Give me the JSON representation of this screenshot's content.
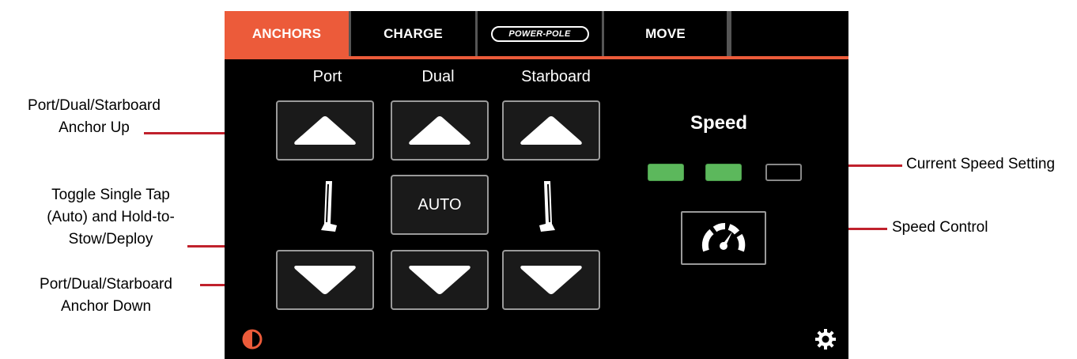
{
  "tabs": [
    {
      "label": "ANCHORS",
      "active": true
    },
    {
      "label": "CHARGE",
      "active": false
    },
    {
      "label": "POWER-POLE",
      "active": false,
      "type": "logo"
    },
    {
      "label": "MOVE",
      "active": false
    },
    {
      "label": "",
      "active": false
    }
  ],
  "columns": {
    "port": "Port",
    "dual": "Dual",
    "starboard": "Starboard"
  },
  "auto_button": "AUTO",
  "speed": {
    "label": "Speed",
    "levels": [
      {
        "on": true,
        "color": "#5cb85c"
      },
      {
        "on": true,
        "color": "#5cb85c"
      },
      {
        "on": false,
        "color": "#000000"
      }
    ]
  },
  "callouts": {
    "anchor_up": [
      "Port/Dual/Starboard",
      "Anchor Up"
    ],
    "toggle": [
      "Toggle Single Tap",
      "(Auto) and Hold-to-",
      "Stow/Deploy"
    ],
    "anchor_down": [
      "Port/Dual/Starboard",
      "Anchor Down"
    ],
    "current_speed": "Current Speed Setting",
    "speed_control": "Speed Control"
  },
  "icons": {
    "contrast": "contrast-icon",
    "settings": "gear-icon",
    "speed_control": "speedometer-icon"
  },
  "colors": {
    "accent": "#ec5b3a",
    "callout_line": "#c0212c",
    "speed_on": "#5cb85c"
  }
}
